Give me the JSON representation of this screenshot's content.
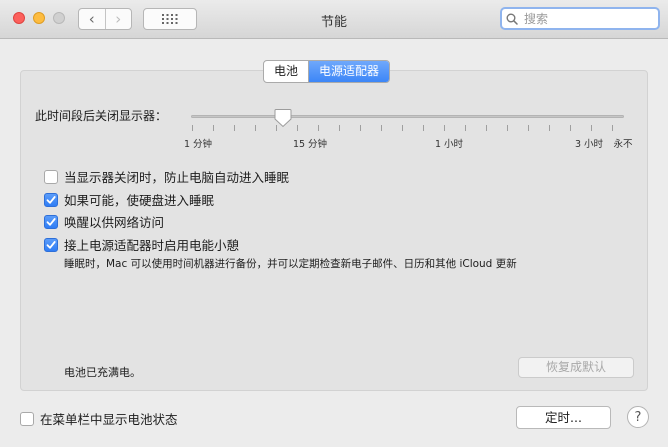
{
  "window": {
    "title": "节能"
  },
  "search": {
    "placeholder": "搜索"
  },
  "tabs": [
    {
      "label": "电池",
      "active": false
    },
    {
      "label": "电源适配器",
      "active": true
    }
  ],
  "display_sleep": {
    "label": "此时间段后关闭显示器：",
    "tick_labels": [
      "1 分钟",
      "15 分钟",
      "1 小时",
      "3 小时",
      "永不"
    ],
    "current_value": "15 分钟"
  },
  "options": [
    {
      "label": "当显示器关闭时，防止电脑自动进入睡眠",
      "checked": false
    },
    {
      "label": "如果可能，使硬盘进入睡眠",
      "checked": true
    },
    {
      "label": "唤醒以供网络访问",
      "checked": true
    },
    {
      "label": "接上电源适配器时启用电能小憩",
      "checked": true
    }
  ],
  "power_nap_description": "睡眠时，Mac 可以使用时间机器进行备份，并可以定期检查新电子邮件、日历和其他 iCloud 更新",
  "battery_status": "电池已充满电。",
  "restore_defaults_label": "恢复成默认",
  "show_battery_status": {
    "label": "在菜单栏中显示电池状态",
    "checked": false
  },
  "schedule_label": "定时...",
  "help_label": "?",
  "colors": {
    "accent": "#3c86f7",
    "search_focus": "#8fb4ee"
  }
}
